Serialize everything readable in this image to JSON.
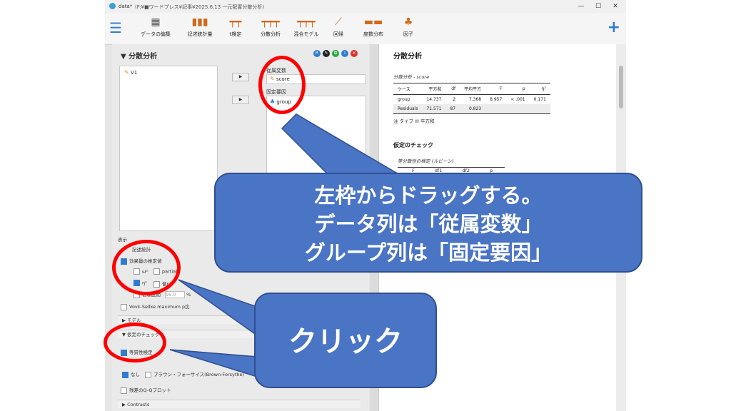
{
  "window": {
    "app_title": "data*",
    "path": "(F:¥■ワードプレス¥記事¥2025.6.13 一元配置分散分析)"
  },
  "toolbar": {
    "buttons": [
      {
        "label": "データの編集",
        "icon": "table-icon"
      },
      {
        "label": "記述統計量",
        "icon": "bar-chart-icon"
      },
      {
        "label": "t検定",
        "icon": "ttest-icon"
      },
      {
        "label": "分散分析",
        "icon": "anova-icon"
      },
      {
        "label": "混合モデル",
        "icon": "mixed-model-icon"
      },
      {
        "label": "回帰",
        "icon": "regression-icon"
      },
      {
        "label": "度数分布",
        "icon": "frequency-icon"
      },
      {
        "label": "因子",
        "icon": "factor-icon"
      }
    ]
  },
  "left": {
    "title": "分散分析",
    "variables": [
      "V1"
    ],
    "dependent_label": "従属変数",
    "dependent_value": "score",
    "fixed_label": "固定要因",
    "fixed_value": "group",
    "display_label": "表示",
    "descriptives": "記述統計",
    "effect_size": "効果量の推定値",
    "omega": "ω²",
    "partial": "partial",
    "eta": "η²",
    "partial_eta": "偏η²",
    "ci_label": "信頼区間",
    "ci_value": "95.0",
    "ci_unit": "%",
    "vovk": "Vovk-Sellke maximum p比",
    "model": "モデル",
    "assumptions": "仮定のチェック",
    "homogeneity": "等質性検定",
    "correction_none": "なし",
    "brown_forsythe": "ブラウン・フォーサイス(Brown-Forsythe)",
    "qq": "残差のQ-Qプロット",
    "contrasts": "Contrasts"
  },
  "right": {
    "title": "分散分析",
    "table_caption": "分散分析 - score",
    "headers": [
      "ケース",
      "平方和",
      "df",
      "平均平方",
      "F",
      "p",
      "η²"
    ],
    "rows": [
      [
        "group",
        "14.737",
        "2",
        "7.368",
        "8.957",
        "< .001",
        "0.171"
      ],
      [
        "Residuals",
        "71.571",
        "87",
        "0.823",
        "",
        "",
        ""
      ]
    ],
    "note": "注 タイプ III 平方和",
    "assumption_title": "仮定のチェック",
    "levene_caption": "等分散性の検定 (ルビーン)",
    "levene_headers": [
      "F",
      "df1",
      "df2",
      "p"
    ]
  },
  "annotations": {
    "callout1": [
      "左枠からドラッグする。",
      "データ列は「従属変数」",
      "グループ列は「固定要因」"
    ],
    "callout2": "クリック"
  },
  "colors": {
    "accent": "#2f7dd1",
    "circle": "#ff0000",
    "callout": "#4a74c4"
  }
}
